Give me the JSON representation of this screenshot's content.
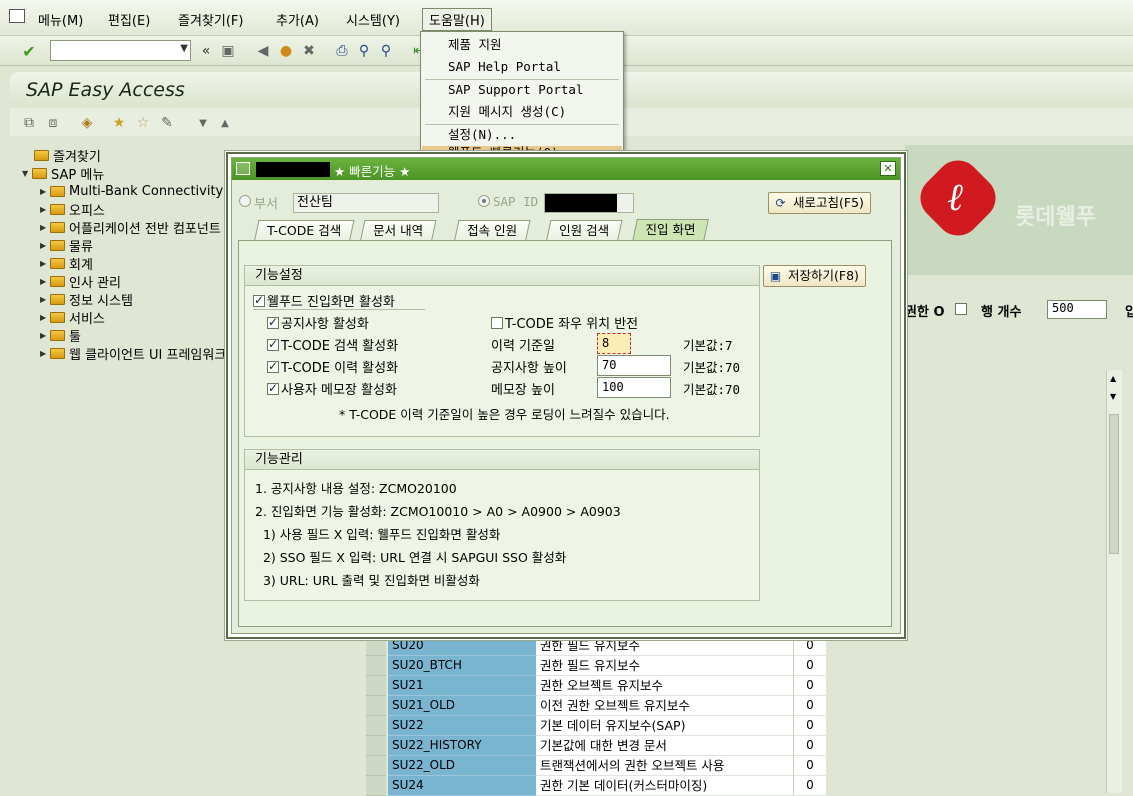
{
  "menubar": {
    "items": [
      "메뉴(M)",
      "편집(E)",
      "즐겨찾기(F)",
      "추가(A)",
      "시스템(Y)",
      "도움말(H)"
    ]
  },
  "title": "SAP Easy Access",
  "help_menu": {
    "items": [
      "제품 지원",
      "SAP Help Portal",
      "SAP Support Portal",
      "지원 메시지 생성(C)",
      "설정(N)...",
      "웰푸드 빠른기능(Q)"
    ]
  },
  "tree": {
    "favorites": "즐겨찾기",
    "sap_menu": "SAP 메뉴",
    "children": [
      "Multi-Bank Connectivity",
      "오피스",
      "어플리케이션 전반 컴포넌트",
      "물류",
      "회계",
      "인사 관리",
      "정보 시스템",
      "서비스",
      "툴",
      "웹 클라이언트 UI 프레임워크"
    ]
  },
  "banner": {
    "text": "롯데웰푸"
  },
  "right_filter": {
    "auth_label": "권한 O",
    "rowcount_label": "행 개수",
    "rowcount_value": "500",
    "cut_label": "입"
  },
  "grid": {
    "rows": [
      {
        "code": "SU20",
        "desc": "권한 필드 유지보수",
        "num": "0"
      },
      {
        "code": "SU20_BTCH",
        "desc": "권한 필드 유지보수",
        "num": "0"
      },
      {
        "code": "SU21",
        "desc": "권한 오브젝트 유지보수",
        "num": "0"
      },
      {
        "code": "SU21_OLD",
        "desc": "이전 권한 오브젝트 유지보수",
        "num": "0"
      },
      {
        "code": "SU22",
        "desc": "기본 데이터 유지보수(SAP)",
        "num": "0"
      },
      {
        "code": "SU22_HISTORY",
        "desc": "기본값에 대한 변경 문서",
        "num": "0"
      },
      {
        "code": "SU22_OLD",
        "desc": "트랜잭션에서의 권한 오브젝트 사용",
        "num": "0"
      },
      {
        "code": "SU24",
        "desc": "권한 기본 데이터(커스터마이징)",
        "num": "0"
      }
    ]
  },
  "dialog": {
    "title": "★ 빠른기능 ★",
    "dept_label": "부서",
    "dept_value": "전산팀",
    "sapid_label": "SAP ID",
    "refresh_button": "새로고침(F5)",
    "save_button": "저장하기(F8)",
    "tabs": [
      "T-CODE 검색",
      "문서 내역",
      "접속 인원",
      "인원 검색",
      "진입 화면"
    ],
    "active_tab": 4,
    "settings": {
      "title": "기능설정",
      "main_check": "웰푸드 진입화면 활성화",
      "notice_check": "공지사항 활성화",
      "tcode_search_check": "T-CODE 검색 활성화",
      "tcode_history_check": "T-CODE 이력 활성화",
      "memo_check": "사용자 메모장 활성화",
      "lr_swap_check": "T-CODE 좌우 위치 반전",
      "history_days_label": "이력 기준일",
      "history_days_value": "8",
      "history_days_default": "기본값:7",
      "notice_height_label": "공지사항 높이",
      "notice_height_value": "70",
      "notice_height_default": "기본값:70",
      "memo_height_label": "메모장 높이",
      "memo_height_value": "100",
      "memo_height_default": "기본값:70",
      "note": "* T-CODE 이력 기준일이 높은 경우 로딩이 느려질수 있습니다."
    },
    "management": {
      "title": "기능관리",
      "lines": [
        "1. 공지사항 내용 설정: ZCMO20100",
        "2. 진입화면 기능 활성화: ZCMO10010 > A0 > A0900 > A0903",
        "  1) 사용 필드 X 입력: 웰푸드 진입화면 활성화",
        "  2) SSO 필드 X 입력: URL 연결 시 SAPGUI SSO 활성화",
        "  3) URL: URL 출력 및 진입화면 비활성화"
      ]
    }
  }
}
